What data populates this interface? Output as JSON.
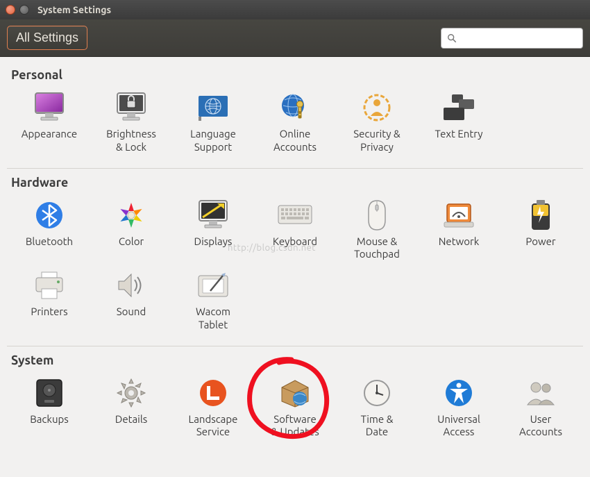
{
  "window": {
    "title": "System Settings"
  },
  "toolbar": {
    "all_settings_label": "All Settings",
    "search_placeholder": ""
  },
  "watermark_text": "http://blog.csdn.net",
  "sections": {
    "personal": {
      "title": "Personal",
      "items": [
        {
          "id": "appearance",
          "label": "Appearance"
        },
        {
          "id": "brightness-lock",
          "label": "Brightness\n& Lock"
        },
        {
          "id": "language-support",
          "label": "Language\nSupport"
        },
        {
          "id": "online-accounts",
          "label": "Online\nAccounts"
        },
        {
          "id": "security-privacy",
          "label": "Security &\nPrivacy"
        },
        {
          "id": "text-entry",
          "label": "Text Entry"
        }
      ]
    },
    "hardware": {
      "title": "Hardware",
      "items": [
        {
          "id": "bluetooth",
          "label": "Bluetooth"
        },
        {
          "id": "color",
          "label": "Color"
        },
        {
          "id": "displays",
          "label": "Displays"
        },
        {
          "id": "keyboard",
          "label": "Keyboard"
        },
        {
          "id": "mouse-touchpad",
          "label": "Mouse &\nTouchpad"
        },
        {
          "id": "network",
          "label": "Network"
        },
        {
          "id": "power",
          "label": "Power"
        },
        {
          "id": "printers",
          "label": "Printers"
        },
        {
          "id": "sound",
          "label": "Sound"
        },
        {
          "id": "wacom-tablet",
          "label": "Wacom\nTablet"
        }
      ]
    },
    "system": {
      "title": "System",
      "items": [
        {
          "id": "backups",
          "label": "Backups"
        },
        {
          "id": "details",
          "label": "Details"
        },
        {
          "id": "landscape-service",
          "label": "Landscape\nService"
        },
        {
          "id": "software-updates",
          "label": "Software\n& Updates"
        },
        {
          "id": "time-date",
          "label": "Time &\nDate"
        },
        {
          "id": "universal-access",
          "label": "Universal\nAccess"
        },
        {
          "id": "user-accounts",
          "label": "User\nAccounts"
        }
      ]
    }
  }
}
